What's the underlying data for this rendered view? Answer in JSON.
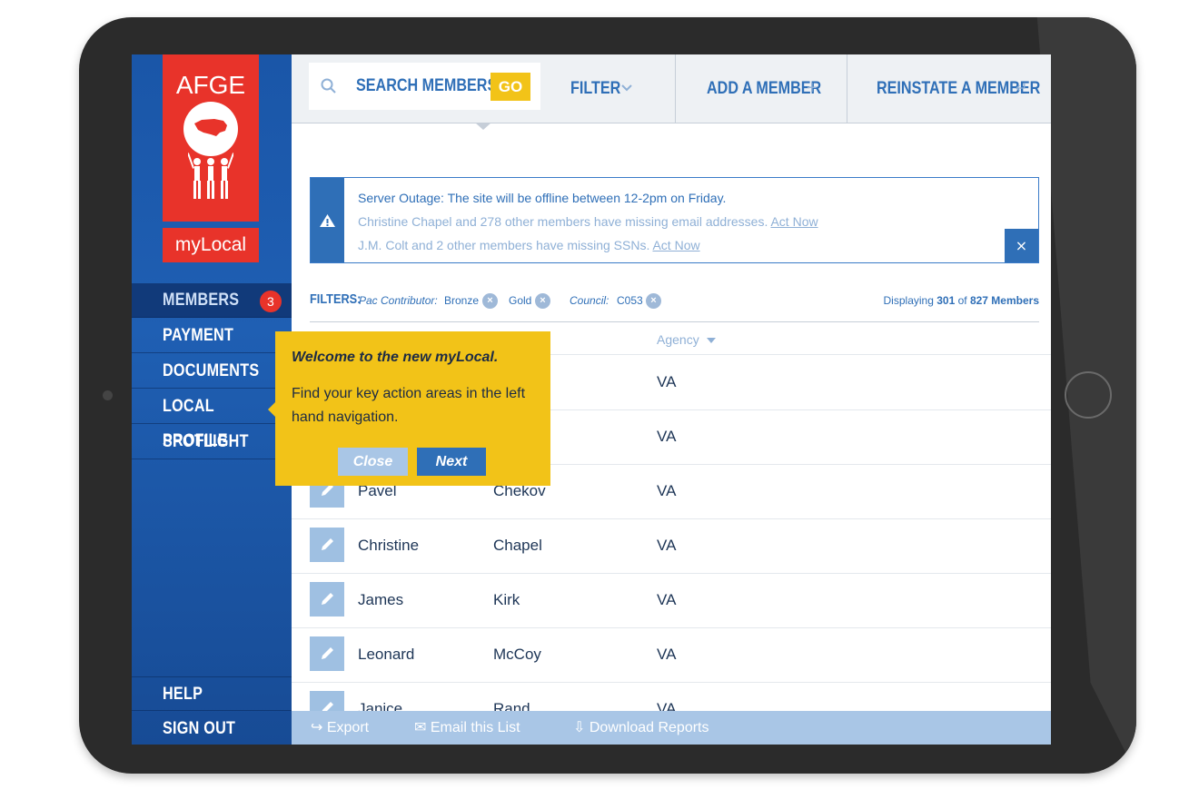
{
  "sidebar": {
    "logo_text": "AFGE",
    "app_name": "myLocal",
    "nav": [
      {
        "label": "MEMBERS",
        "badge": "3"
      },
      {
        "label": "PAYMENT"
      },
      {
        "label": "DOCUMENTS"
      },
      {
        "label": "LOCAL PROFILE"
      },
      {
        "label": "SPOTLIGHT"
      }
    ],
    "bottom_nav": [
      {
        "label": "HELP"
      },
      {
        "label": "SIGN OUT"
      }
    ]
  },
  "topbar": {
    "search_label": "SEARCH MEMBERS",
    "go_label": "GO",
    "filter_label": "FILTER",
    "add_label": "ADD A MEMBER",
    "add_icon": "+",
    "reinstate_label": "REINSTATE A MEMBER",
    "reinstate_icon": "↵"
  },
  "alert": {
    "line1": "Server Outage: The site will be offline between 12-2pm on Friday.",
    "line2": "Christine Chapel and 278 other members have missing email addresses.",
    "line2_link": "Act Now",
    "line3": "J.M. Colt and 2 other members have missing SSNs.",
    "line3_link": "Act Now",
    "close": "×"
  },
  "filters": {
    "label": "FILTERS:",
    "pac_label": "Pac Contributor:",
    "pac_values": [
      "Bronze",
      "Gold"
    ],
    "council_label": "Council:",
    "council_value": "C053",
    "display_prefix": "Displaying",
    "display_shown": "301",
    "display_of": "of",
    "display_total": "827 Members"
  },
  "table": {
    "agency_header": "Agency",
    "rows": [
      {
        "first": "",
        "last": "",
        "agency": "VA"
      },
      {
        "first": "",
        "last": "",
        "agency": "VA"
      },
      {
        "first": "Pavel",
        "last": "Chekov",
        "agency": "VA"
      },
      {
        "first": "Christine",
        "last": "Chapel",
        "agency": "VA"
      },
      {
        "first": "James",
        "last": "Kirk",
        "agency": "VA"
      },
      {
        "first": "Leonard",
        "last": "McCoy",
        "agency": "VA"
      },
      {
        "first": "Janice",
        "last": "Rand",
        "agency": "VA"
      }
    ]
  },
  "bottombar": {
    "export": "Export",
    "email": "Email this List",
    "download": "Download Reports"
  },
  "tooltip": {
    "title": "Welcome to the new myLocal.",
    "body": "Find your key action areas in the left hand navigation.",
    "close": "Close",
    "next": "Next"
  },
  "colors": {
    "brand_blue": "#2f6fb7",
    "brand_red": "#e8332a",
    "accent_yellow": "#f2c318",
    "light_blue": "#a9c6e6"
  }
}
